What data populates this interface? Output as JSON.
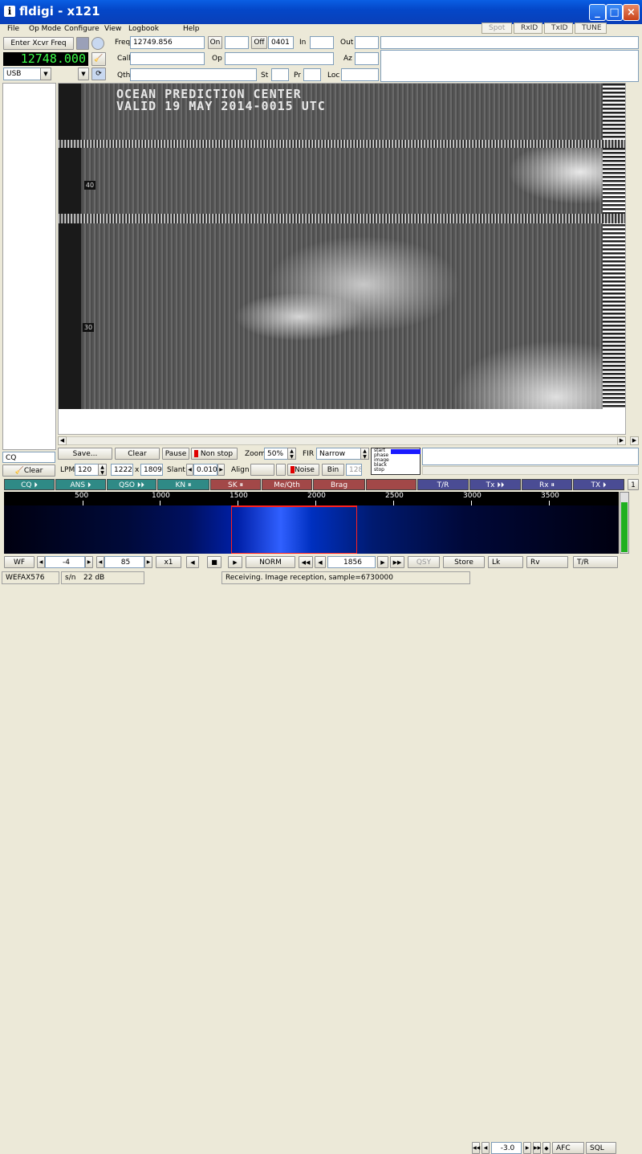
{
  "window": {
    "title": "fldigi - x121",
    "icon": "info-icon"
  },
  "menu": [
    "File",
    "Op Mode",
    "Configure",
    "View",
    "Logbook",
    "Help"
  ],
  "top_toggles": [
    {
      "label": "Spot",
      "enabled": false
    },
    {
      "label": "RxID"
    },
    {
      "label": "TxID"
    },
    {
      "label": "TUNE"
    }
  ],
  "rig": {
    "enter_freq": "Enter Xcvr Freq",
    "frequency": "12748.000",
    "mode": "USB"
  },
  "log": {
    "freq_label": "Freq",
    "freq": "12749.856",
    "on_label": "On",
    "on": "",
    "off_label": "Off",
    "off": "0401",
    "in_label": "In",
    "in": "",
    "out_label": "Out",
    "out": "",
    "call_label": "Call",
    "call": "",
    "op_label": "Op",
    "op": "",
    "az_label": "Az",
    "az": "",
    "qth_label": "Qth",
    "qth": "",
    "st_label": "St",
    "st": "",
    "pr_label": "Pr",
    "pr": "",
    "loc_label": "Loc",
    "loc": ""
  },
  "image": {
    "overlay_line1": "OCEAN PREDICTION CENTER",
    "overlay_line2": "VALID 19 MAY 2014-0015 UTC",
    "lat1": "40",
    "lat2": "30"
  },
  "wefax": {
    "save": "Save...",
    "clear": "Clear",
    "pause": "Pause",
    "nonstop": "Non stop",
    "zoom_label": "Zoom",
    "zoom": "50%",
    "fir_label": "FIR",
    "fir": "Narrow",
    "lpm_label": "LPM",
    "lpm": "120",
    "width": "1222",
    "x_label": "x",
    "height": "1809",
    "slant_label": "Slant",
    "slant": "0.010",
    "align_label": "Align",
    "noise": "Noise",
    "bin": "Bin",
    "bin_val": "128",
    "phase_states": [
      "start",
      "phase",
      "image",
      "black",
      "stop"
    ]
  },
  "left_panel": {
    "cq": "CQ",
    "clear": "Clear"
  },
  "macros": [
    {
      "label": "CQ",
      "glyph": "⏵",
      "color": "teal"
    },
    {
      "label": "ANS",
      "glyph": "⏵",
      "color": "teal"
    },
    {
      "label": "QSO",
      "glyph": "⏵⏵",
      "color": "teal"
    },
    {
      "label": "KN",
      "glyph": "⏸",
      "color": "teal"
    },
    {
      "label": "SK",
      "glyph": "⏸",
      "color": "red"
    },
    {
      "label": "Me/Qth",
      "glyph": "",
      "color": "red"
    },
    {
      "label": "Brag",
      "glyph": "",
      "color": "red"
    },
    {
      "label": "",
      "glyph": "",
      "color": "red"
    },
    {
      "label": "T/R",
      "glyph": "",
      "color": "blue"
    },
    {
      "label": "Tx",
      "glyph": "⏵⏵",
      "color": "blue"
    },
    {
      "label": "Rx",
      "glyph": "⏸",
      "color": "blue"
    },
    {
      "label": "TX",
      "glyph": "⏵",
      "color": "blue"
    }
  ],
  "macro_page": "1",
  "waterfall": {
    "ticks": [
      "500",
      "1000",
      "1500",
      "2000",
      "2500",
      "3000",
      "3500"
    ]
  },
  "wf_controls": {
    "wf": "WF",
    "ref": "-4",
    "range": "85",
    "zoom": "x1",
    "norm": "NORM",
    "freq": "1856",
    "qsy": "QSY",
    "store": "Store",
    "lk": "Lk",
    "rv": "Rv",
    "tr": "T/R"
  },
  "status": {
    "mode": "WEFAX576",
    "sn_label": "s/n",
    "sn": "22 dB",
    "message": "Receiving. Image reception, sample=6730000",
    "afc_val": "-3.0",
    "afc": "AFC",
    "sql": "SQL"
  }
}
